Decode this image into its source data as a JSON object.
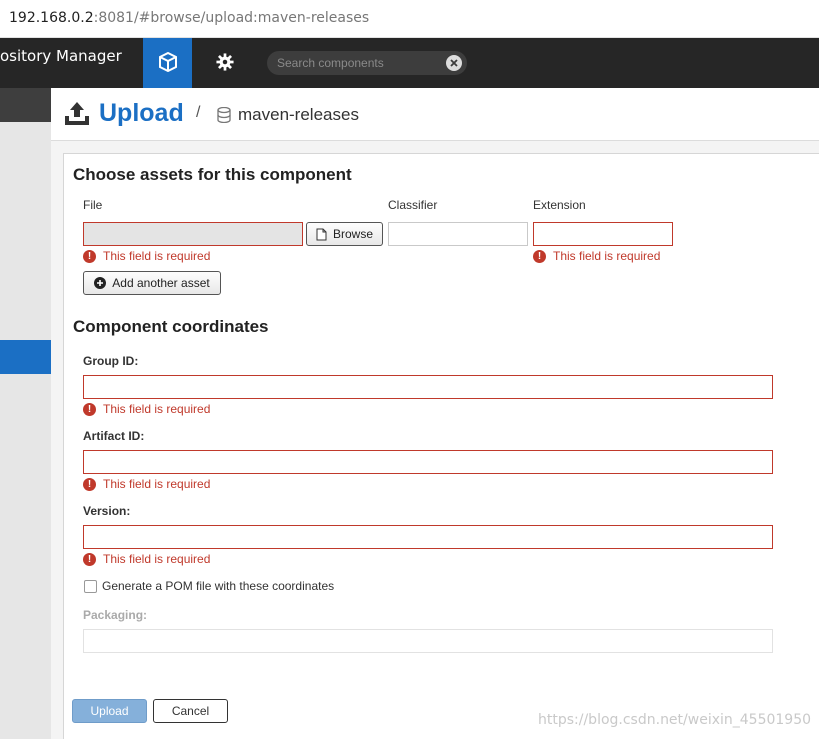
{
  "browser": {
    "url_host": "192.168.0.2",
    "url_rest": ":8081/#browse/upload:maven-releases"
  },
  "header": {
    "app_title": "ository Manager",
    "search_placeholder": "Search components"
  },
  "page": {
    "title": "Upload",
    "separator": "/",
    "repository": "maven-releases"
  },
  "assets": {
    "section_title": "Choose assets for this component",
    "file_label": "File",
    "classifier_label": "Classifier",
    "extension_label": "Extension",
    "browse_label": "Browse",
    "file_error": "This field is required",
    "extension_error": "This field is required",
    "add_asset_label": "Add another asset"
  },
  "coordinates": {
    "section_title": "Component coordinates",
    "group_label": "Group ID:",
    "group_error": "This field is required",
    "artifact_label": "Artifact ID:",
    "artifact_error": "This field is required",
    "version_label": "Version:",
    "version_error": "This field is required",
    "generate_pom_label": "Generate a POM file with these coordinates",
    "packaging_label": "Packaging:"
  },
  "actions": {
    "upload_label": "Upload",
    "cancel_label": "Cancel"
  },
  "watermark": "https://blog.csdn.net/weixin_45501950",
  "colors": {
    "accent": "#1b6fc4",
    "error": "#c0392b",
    "header_bg": "#262626"
  }
}
